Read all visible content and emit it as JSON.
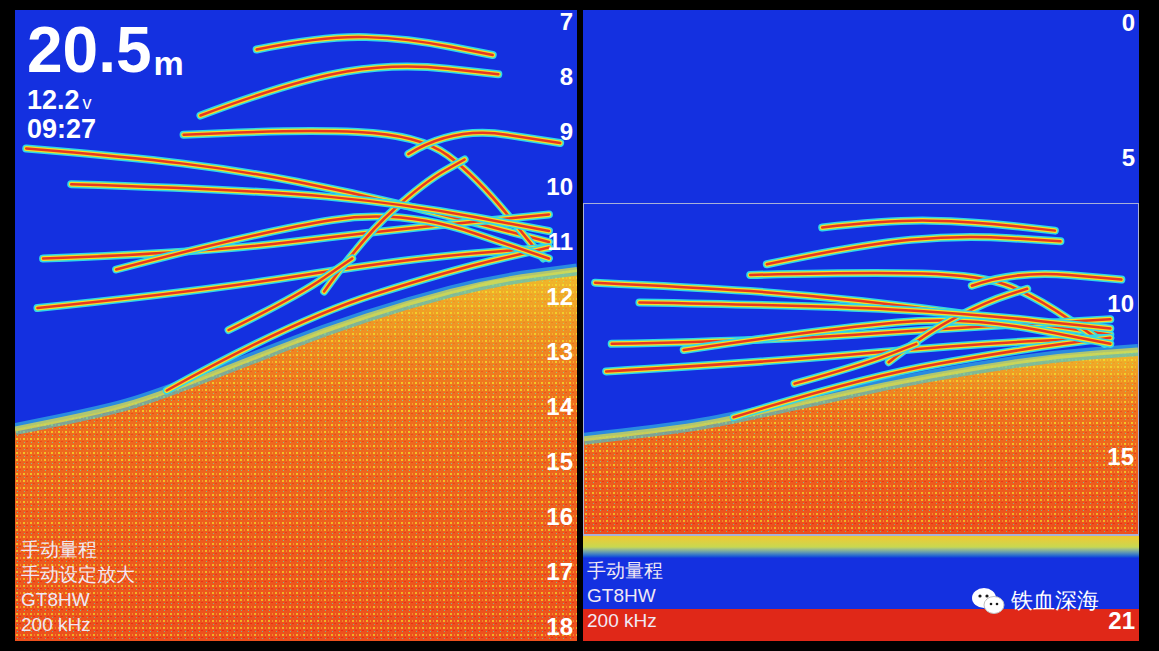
{
  "left_pane": {
    "depth": "20.5",
    "unit": "m",
    "voltage": "12.2",
    "voltage_unit": "v",
    "time": "09:27",
    "ticks": [
      "7",
      "8",
      "9",
      "10",
      "11",
      "12",
      "13",
      "14",
      "15",
      "16",
      "17",
      "18"
    ],
    "labels": [
      "手动量程",
      "手动设定放大",
      "GT8HW",
      "200 kHz"
    ]
  },
  "right_pane": {
    "overview_ticks": [
      "0",
      "5"
    ],
    "zoom_ticks": [
      "10",
      "15"
    ],
    "bottom_ticks": [
      "21"
    ],
    "labels": [
      "手动量程",
      "GT8HW",
      "200 kHz"
    ]
  },
  "echoes": {
    "traces": [
      {
        "points": [
          [
            0.43,
            7.5
          ],
          [
            0.55,
            7.25
          ],
          [
            0.7,
            7.3
          ],
          [
            0.85,
            7.6
          ]
        ]
      },
      {
        "points": [
          [
            0.33,
            8.7
          ],
          [
            0.5,
            8.05
          ],
          [
            0.68,
            7.75
          ],
          [
            0.86,
            7.95
          ]
        ]
      },
      {
        "points": [
          [
            0.02,
            9.3
          ],
          [
            0.2,
            9.45
          ],
          [
            0.4,
            9.7
          ],
          [
            0.6,
            10.1
          ],
          [
            0.8,
            10.6
          ],
          [
            0.95,
            11.0
          ]
        ]
      },
      {
        "points": [
          [
            0.3,
            9.05
          ],
          [
            0.5,
            8.95
          ],
          [
            0.72,
            9.05
          ],
          [
            0.82,
            9.8
          ],
          [
            0.94,
            11.3
          ]
        ]
      },
      {
        "points": [
          [
            0.05,
            11.3
          ],
          [
            0.33,
            11.2
          ],
          [
            0.65,
            10.8
          ],
          [
            0.95,
            10.5
          ]
        ]
      },
      {
        "points": [
          [
            0.04,
            12.2
          ],
          [
            0.33,
            11.9
          ],
          [
            0.7,
            11.3
          ],
          [
            0.95,
            11.1
          ]
        ]
      },
      {
        "points": [
          [
            0.27,
            13.7
          ],
          [
            0.5,
            12.4
          ],
          [
            0.78,
            11.5
          ],
          [
            0.95,
            11.1
          ]
        ]
      },
      {
        "points": [
          [
            0.18,
            11.5
          ],
          [
            0.44,
            10.8
          ],
          [
            0.69,
            10.4
          ],
          [
            0.95,
            11.3
          ]
        ]
      },
      {
        "points": [
          [
            0.55,
            11.9
          ],
          [
            0.62,
            10.9
          ],
          [
            0.73,
            9.9
          ],
          [
            0.8,
            9.5
          ]
        ]
      },
      {
        "points": [
          [
            0.1,
            9.95
          ],
          [
            0.42,
            10.05
          ],
          [
            0.69,
            10.3
          ],
          [
            0.95,
            10.8
          ]
        ]
      },
      {
        "points": [
          [
            0.7,
            9.4
          ],
          [
            0.78,
            8.9
          ],
          [
            0.97,
            9.2
          ]
        ]
      },
      {
        "points": [
          [
            0.38,
            12.6
          ],
          [
            0.5,
            12.0
          ],
          [
            0.6,
            11.3
          ]
        ]
      }
    ],
    "bottom": {
      "points": [
        [
          0,
          14.4
        ],
        [
          0.15,
          14.1
        ],
        [
          0.25,
          13.8
        ],
        [
          0.4,
          13.2
        ],
        [
          0.55,
          12.6
        ],
        [
          0.7,
          12.1
        ],
        [
          0.85,
          11.7
        ],
        [
          1,
          11.5
        ]
      ]
    }
  },
  "watermark": "铁血深海"
}
